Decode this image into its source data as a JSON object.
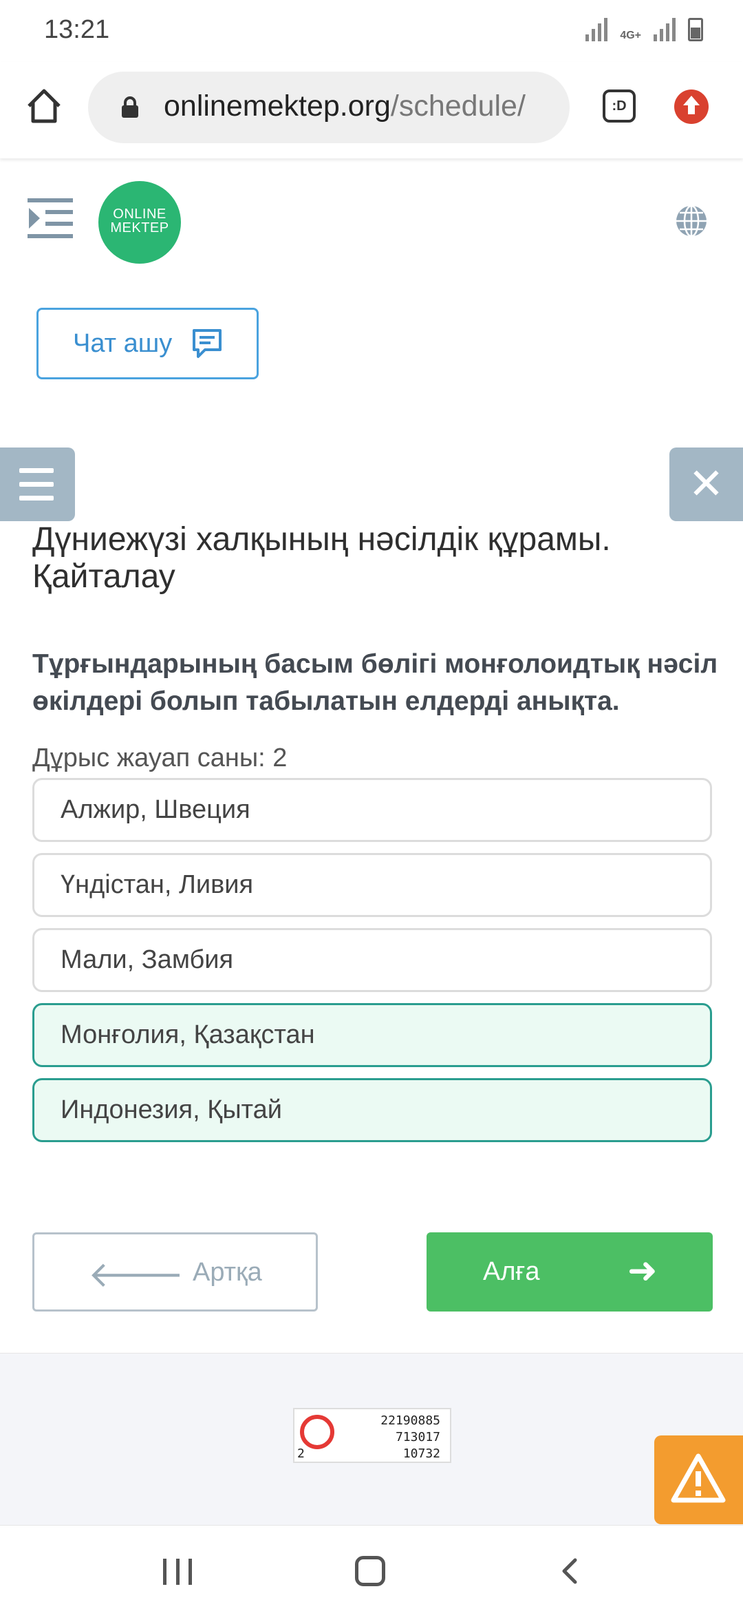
{
  "status_bar": {
    "time": "13:21",
    "network": "4G+"
  },
  "browser": {
    "url_main": "onlinemektep.org",
    "url_path": "/schedule/",
    "tabs_label": ":D"
  },
  "header": {
    "logo_line1": "ONLINE",
    "logo_line2": "MEKTEP"
  },
  "chat_button": {
    "label": "Чат ашу"
  },
  "lesson": {
    "title": "Дүниежүзі халқының нәсілдік құрамы. Қайталау",
    "question": "Тұрғындарының басым бөлігі монғолоидтық нәсіл өкілдері болып табылатын елдерді анықта.",
    "correct_count_label": "Дұрыс жауап саны: 2",
    "options": [
      {
        "label": "Алжир, Швеция",
        "selected": false
      },
      {
        "label": "Үндістан, Ливия",
        "selected": false
      },
      {
        "label": "Мали, Замбия",
        "selected": false
      },
      {
        "label": "Монғолия, Қазақстан",
        "selected": true
      },
      {
        "label": "Индонезия, Қытай",
        "selected": true
      }
    ]
  },
  "navigation": {
    "back_label": "Артқа",
    "next_label": "Алға"
  },
  "footer_counter": {
    "line1": "22190885",
    "line2": "713017",
    "line3": "10732",
    "line4": "2"
  },
  "colors": {
    "accent_green": "#4cbf64",
    "selected_border": "#2a9d8f",
    "warning": "#f39c2f",
    "side_button": "#a3b7c5"
  }
}
